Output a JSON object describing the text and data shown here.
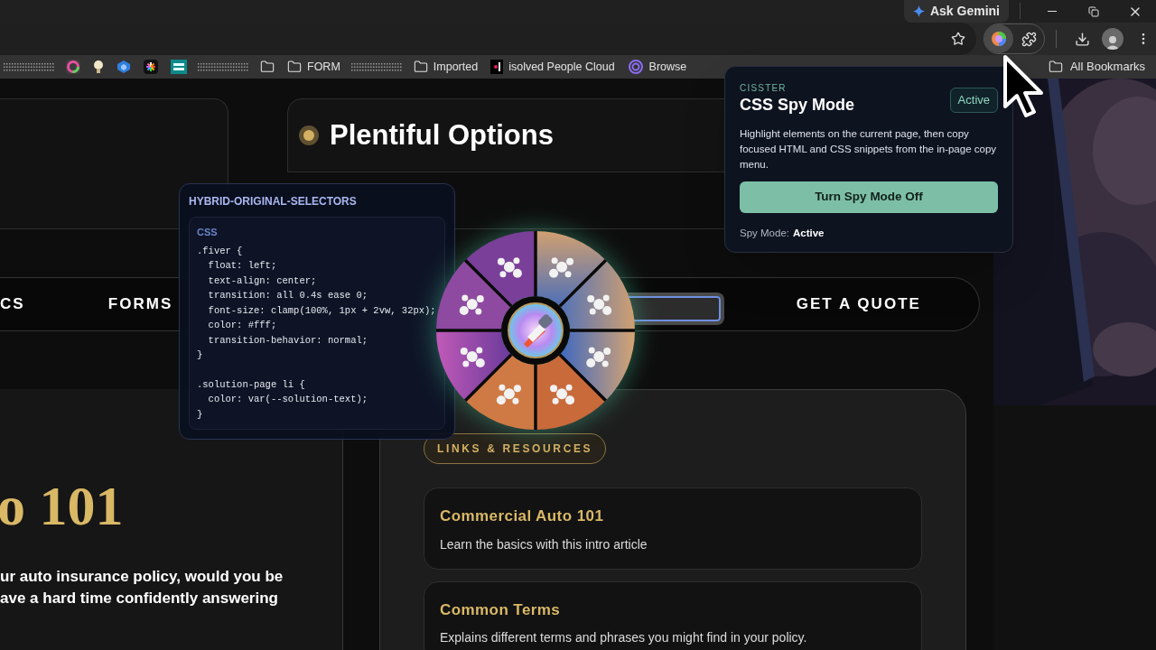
{
  "browser": {
    "ask_button": "Ask Gemini",
    "bookmarks": [
      {
        "kind": "redacted"
      },
      {
        "kind": "icon"
      },
      {
        "kind": "icon"
      },
      {
        "kind": "icon"
      },
      {
        "kind": "icon"
      },
      {
        "kind": "icon"
      },
      {
        "kind": "redacted"
      },
      {
        "kind": "folder"
      },
      {
        "kind": "folder",
        "label": "FORM"
      },
      {
        "kind": "redacted"
      },
      {
        "kind": "folder",
        "label": "Imported"
      },
      {
        "kind": "site",
        "label": "isolved People Cloud"
      },
      {
        "kind": "site",
        "label": "Browse"
      }
    ],
    "all_bookmarks": "All Bookmarks"
  },
  "popup": {
    "brand": "CISSTER",
    "title": "CSS Spy Mode",
    "status_badge": "Active",
    "description": "Highlight elements on the current page, then copy focused HTML and CSS snippets from the in-page copy menu.",
    "button": "Turn Spy Mode Off",
    "status_label": "Spy Mode:",
    "status_value": "Active"
  },
  "code_panel": {
    "title": "HYBRID-ORIGINAL-SELECTORS",
    "language": "CSS",
    "blocks": [
      [
        ".fiver {",
        "  float: left;",
        "  text-align: center;",
        "  transition: all 0.4s ease 0;",
        "  font-size: clamp(100%, 1px + 2vw, 32px);",
        "  color: #fff;",
        "  transition-behavior: normal;",
        "}"
      ],
      [
        ".solution-page li {",
        "  color: var(--solution-text);",
        "}"
      ]
    ]
  },
  "page": {
    "section_title": "Plentiful Options",
    "nav": [
      {
        "label": "CS"
      },
      {
        "label": "FORMS"
      },
      {
        "label": "GET A QUOTE"
      }
    ],
    "intro": {
      "heading": "o 101",
      "lines": [
        "ur auto insurance policy, would you be",
        "ave a hard time confidently answering"
      ]
    },
    "resources": {
      "badge": "LINKS & RESOURCES",
      "items": [
        {
          "title": "Commercial Auto 101",
          "description": "Learn the basics with this intro article"
        },
        {
          "title": "Common Terms",
          "description": "Explains different terms and phrases you might find in your policy."
        }
      ]
    }
  }
}
